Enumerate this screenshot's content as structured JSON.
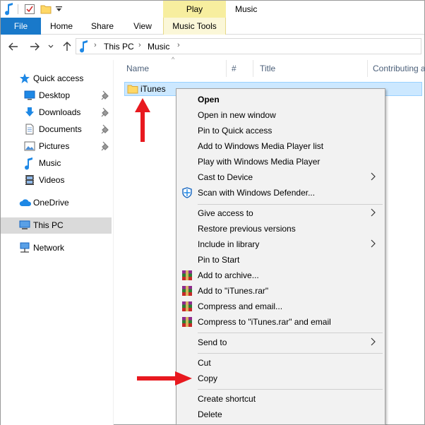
{
  "window": {
    "title": "Music",
    "contextual_tab_header": "Play"
  },
  "ribbon": {
    "tabs": [
      {
        "label": "File"
      },
      {
        "label": "Home"
      },
      {
        "label": "Share"
      },
      {
        "label": "View"
      },
      {
        "label": "Music Tools"
      }
    ]
  },
  "address": {
    "crumbs": [
      "This PC",
      "Music"
    ]
  },
  "navpane": {
    "items": [
      {
        "label": "Quick access",
        "icon": "star-icon"
      },
      {
        "label": "Desktop",
        "icon": "desktop-icon"
      },
      {
        "label": "Downloads",
        "icon": "download-icon"
      },
      {
        "label": "Documents",
        "icon": "documents-icon"
      },
      {
        "label": "Pictures",
        "icon": "pictures-icon"
      },
      {
        "label": "Music",
        "icon": "music-icon"
      },
      {
        "label": "Videos",
        "icon": "videos-icon"
      },
      {
        "label": "OneDrive",
        "icon": "cloud-icon"
      },
      {
        "label": "This PC",
        "icon": "computer-icon"
      },
      {
        "label": "Network",
        "icon": "network-icon"
      }
    ]
  },
  "columns": {
    "name": "Name",
    "number": "#",
    "title": "Title",
    "contributing": "Contributing a"
  },
  "files": [
    {
      "name": "iTunes"
    }
  ],
  "context_menu": {
    "items": [
      {
        "label": "Open"
      },
      {
        "label": "Open in new window"
      },
      {
        "label": "Pin to Quick access"
      },
      {
        "label": "Add to Windows Media Player list"
      },
      {
        "label": "Play with Windows Media Player"
      },
      {
        "label": "Cast to Device"
      },
      {
        "label": "Scan with Windows Defender..."
      },
      {
        "label": "Give access to"
      },
      {
        "label": "Restore previous versions"
      },
      {
        "label": "Include in library"
      },
      {
        "label": "Pin to Start"
      },
      {
        "label": "Add to archive..."
      },
      {
        "label": "Add to \"iTunes.rar\""
      },
      {
        "label": "Compress and email..."
      },
      {
        "label": "Compress to \"iTunes.rar\" and email"
      },
      {
        "label": "Send to"
      },
      {
        "label": "Cut"
      },
      {
        "label": "Copy"
      },
      {
        "label": "Create shortcut"
      },
      {
        "label": "Delete"
      }
    ]
  },
  "colors": {
    "accent": "#1979ca",
    "selection": "#cce8ff",
    "contextual_tab": "#f7ee9f",
    "annotation_arrow": "#e8191f"
  }
}
